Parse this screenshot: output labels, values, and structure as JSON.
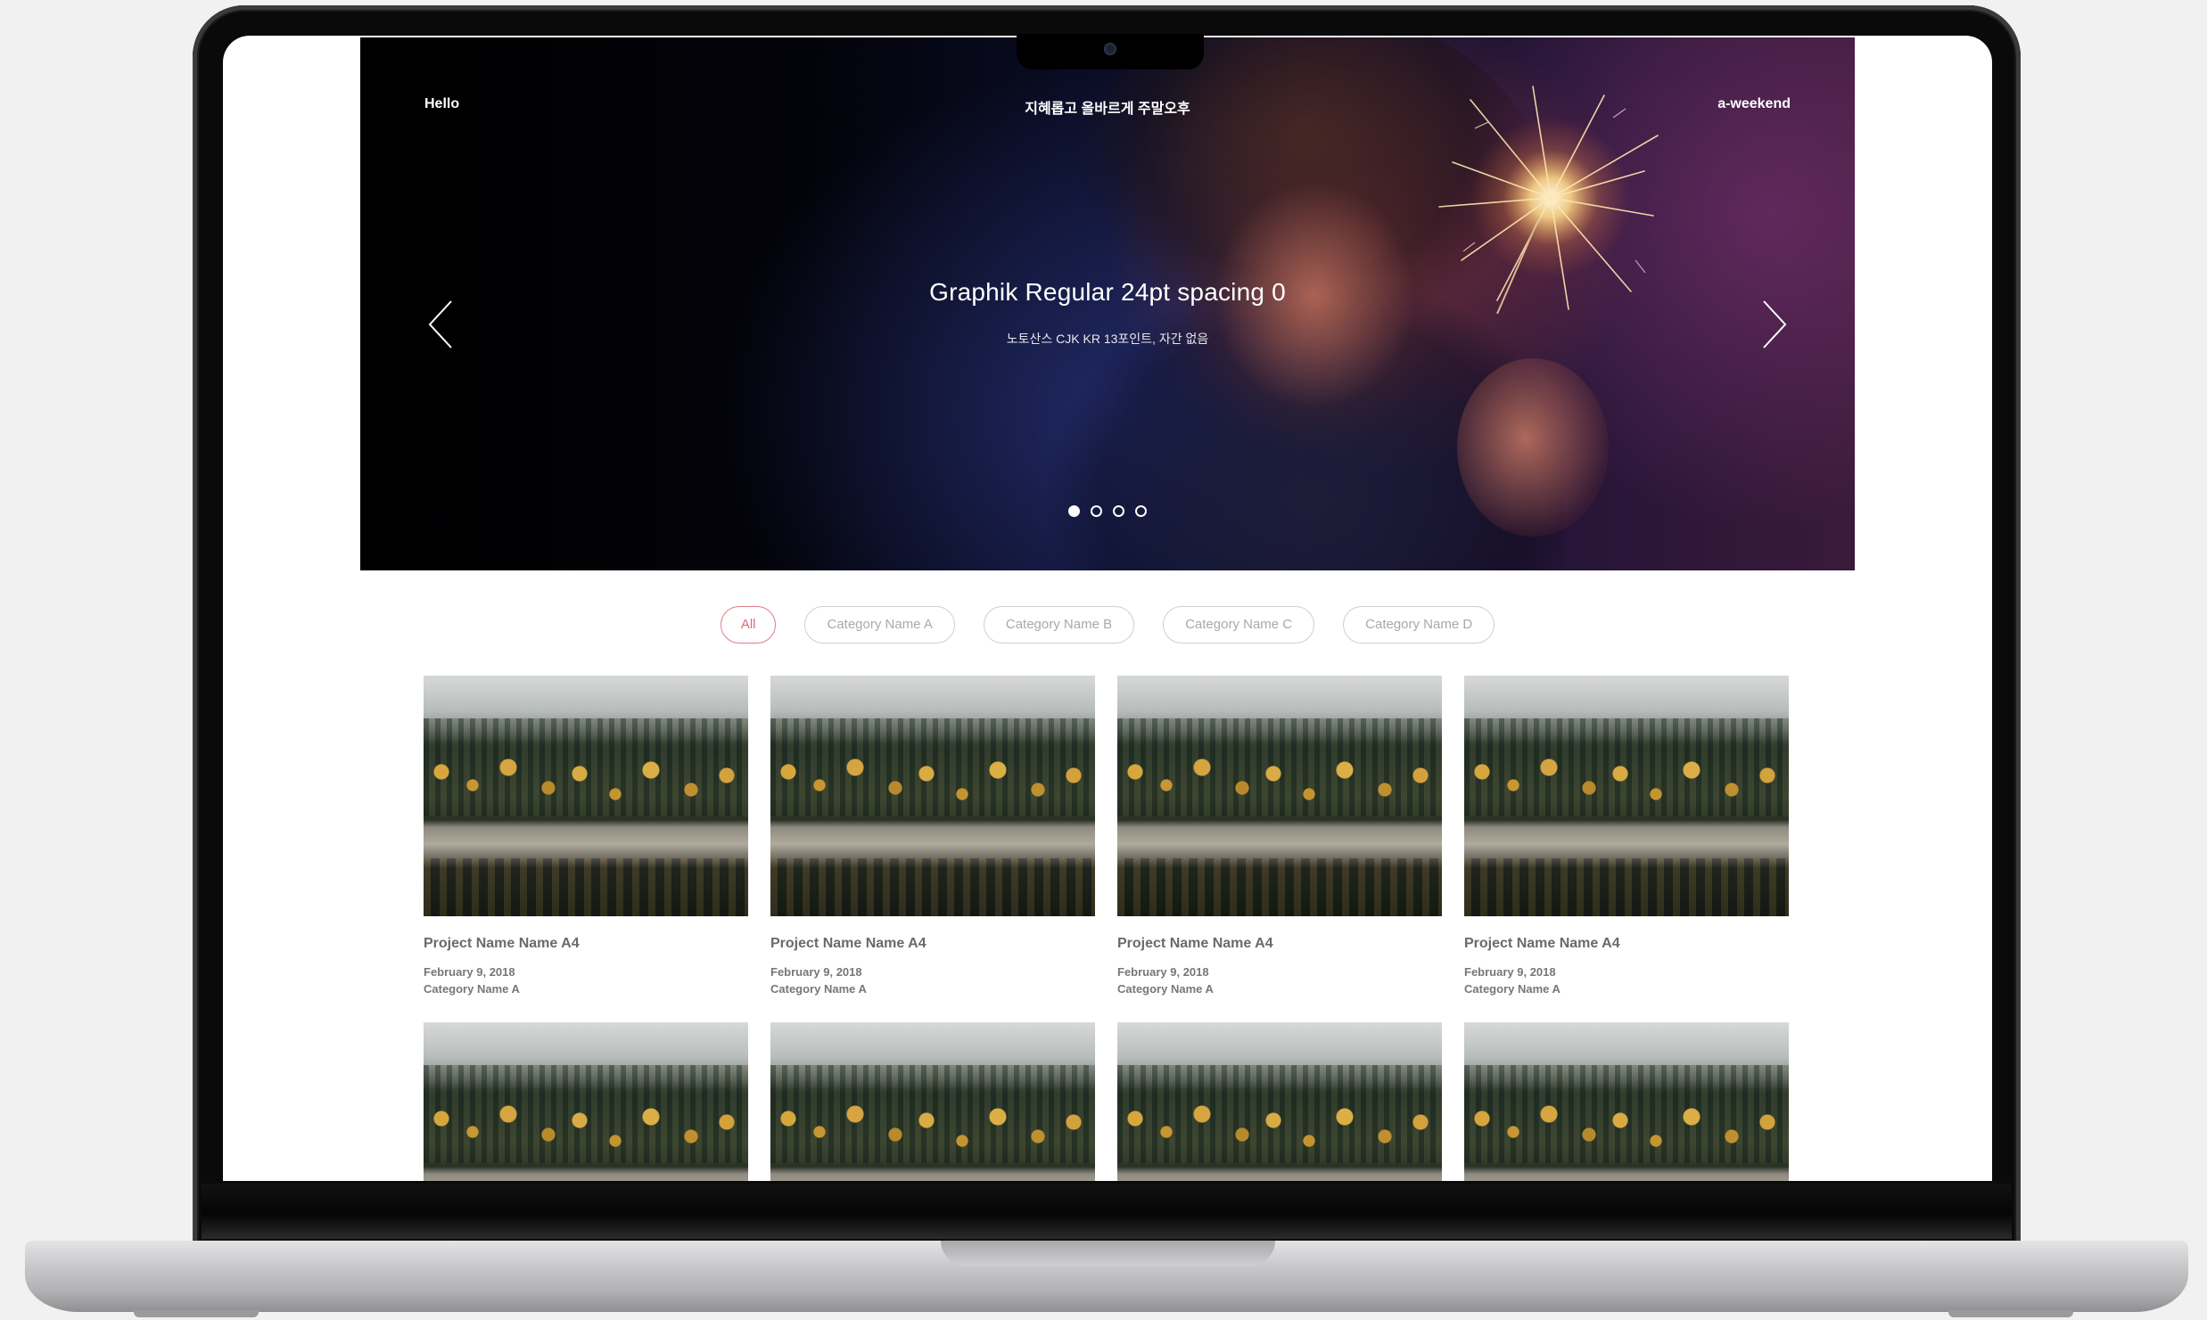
{
  "header": {
    "left": "Hello",
    "center": "지혜롭고 올바르게 주말오후",
    "right": "a-weekend"
  },
  "hero": {
    "title": "Graphik Regular 24pt spacing 0",
    "subtitle": "노토산스 CJK KR 13포인트, 자간 없음",
    "prev_icon": "chevron-left-icon",
    "next_icon": "chevron-right-icon",
    "slide_count": 4,
    "active_slide": 1
  },
  "filters": [
    {
      "label": "All",
      "active": true
    },
    {
      "label": "Category Name A",
      "active": false
    },
    {
      "label": "Category Name B",
      "active": false
    },
    {
      "label": "Category Name C",
      "active": false
    },
    {
      "label": "Category Name D",
      "active": false
    }
  ],
  "projects": [
    {
      "title": "Project Name Name A4",
      "date": "February 9, 2018",
      "category": "Category Name A"
    },
    {
      "title": "Project Name Name A4",
      "date": "February 9, 2018",
      "category": "Category Name A"
    },
    {
      "title": "Project Name Name A4",
      "date": "February 9, 2018",
      "category": "Category Name A"
    },
    {
      "title": "Project Name Name A4",
      "date": "February 9, 2018",
      "category": "Category Name A"
    },
    {
      "title": "",
      "date": "",
      "category": ""
    },
    {
      "title": "",
      "date": "",
      "category": ""
    },
    {
      "title": "",
      "date": "",
      "category": ""
    },
    {
      "title": "",
      "date": "",
      "category": ""
    }
  ],
  "colors": {
    "accent": "#e06a76",
    "pill_border": "#cfcfcf",
    "pill_text": "#a9a9a9",
    "card_text": "#6a6a6a"
  }
}
